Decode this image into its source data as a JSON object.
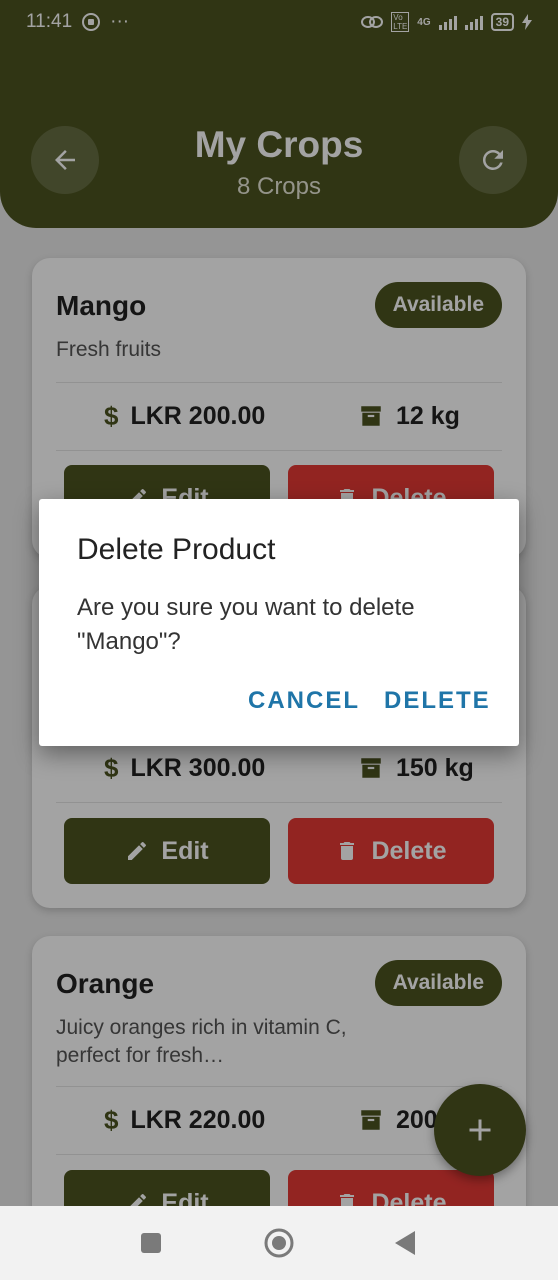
{
  "status_bar": {
    "time": "11:41",
    "more": "···",
    "network": "4G",
    "volte": "Vo LTE",
    "battery": "39"
  },
  "header": {
    "title": "My Crops",
    "subtitle": "8 Crops"
  },
  "crops": [
    {
      "name": "Mango",
      "status": "Available",
      "description": "Fresh fruits",
      "price": "LKR 200.00",
      "quantity": "12 kg",
      "edit_label": "Edit",
      "delete_label": "Delete"
    },
    {
      "name": "",
      "status": "",
      "description": "",
      "price": "LKR 300.00",
      "quantity": "150 kg",
      "edit_label": "Edit",
      "delete_label": "Delete"
    },
    {
      "name": "Orange",
      "status": "Available",
      "description": "Juicy oranges rich in vitamin C, perfect for fresh…",
      "price": "LKR 220.00",
      "quantity": "200",
      "edit_label": "Edit",
      "delete_label": "Delete"
    }
  ],
  "price_symbol": "$",
  "dialog": {
    "title": "Delete Product",
    "message": "Are you sure you want to delete \"Mango\"?",
    "cancel_label": "CANCEL",
    "confirm_label": "DELETE"
  },
  "icons": {
    "back": "arrow-left-icon",
    "refresh": "refresh-icon",
    "quantity": "archive-box-icon",
    "edit": "pencil-icon",
    "delete": "trash-icon",
    "add": "plus-icon"
  },
  "colors": {
    "primary": "#4b5320",
    "danger": "#e53935",
    "dialog_action": "#1f75a8"
  }
}
